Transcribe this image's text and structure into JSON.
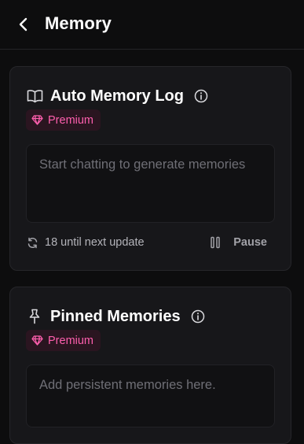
{
  "header": {
    "title": "Memory",
    "back_icon": "chevron-left-icon"
  },
  "auto_memory": {
    "title": "Auto Memory Log",
    "icon": "book-open-icon",
    "info_icon": "info-icon",
    "badge": {
      "label": "Premium",
      "icon": "gem-icon",
      "color": "#ff5fae"
    },
    "placeholder": "Start chatting to generate memories",
    "update_text": "18 until next update",
    "update_icon": "refresh-icon",
    "pause_label": "Pause",
    "pause_icon": "pause-icon"
  },
  "pinned_memories": {
    "title": "Pinned Memories",
    "icon": "pin-icon",
    "info_icon": "info-icon",
    "badge": {
      "label": "Premium",
      "icon": "gem-icon",
      "color": "#ff5fae"
    },
    "placeholder": "Add persistent memories here."
  },
  "colors": {
    "background": "#0d0d0e",
    "card": "#17171a",
    "accent_pink": "#ff5fae"
  }
}
